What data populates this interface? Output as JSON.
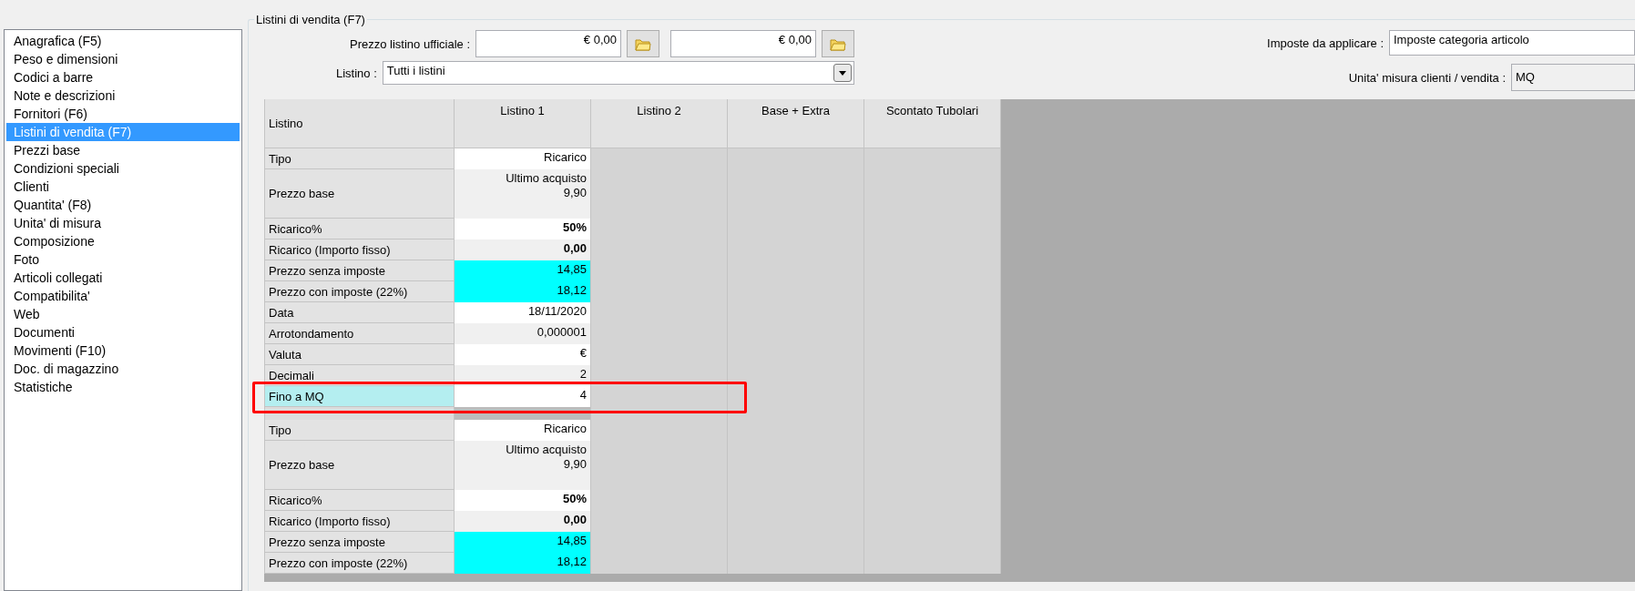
{
  "sidebar": {
    "items": [
      {
        "label": "Anagrafica (F5)",
        "selected": false
      },
      {
        "label": "Peso e dimensioni",
        "selected": false
      },
      {
        "label": "Codici a barre",
        "selected": false
      },
      {
        "label": "Note e descrizioni",
        "selected": false
      },
      {
        "label": "Fornitori (F6)",
        "selected": false
      },
      {
        "label": "Listini di vendita (F7)",
        "selected": true
      },
      {
        "label": "Prezzi base",
        "selected": false
      },
      {
        "label": "Condizioni speciali",
        "selected": false
      },
      {
        "label": "Clienti",
        "selected": false
      },
      {
        "label": "Quantita' (F8)",
        "selected": false
      },
      {
        "label": "Unita' di misura",
        "selected": false
      },
      {
        "label": "Composizione",
        "selected": false
      },
      {
        "label": "Foto",
        "selected": false
      },
      {
        "label": "Articoli collegati",
        "selected": false
      },
      {
        "label": "Compatibilita'",
        "selected": false
      },
      {
        "label": "Web",
        "selected": false
      },
      {
        "label": "Documenti",
        "selected": false
      },
      {
        "label": "Movimenti (F10)",
        "selected": false
      },
      {
        "label": "Doc. di magazzino",
        "selected": false
      },
      {
        "label": "Statistiche",
        "selected": false
      }
    ]
  },
  "panel": {
    "title": "Listini di vendita (F7)",
    "official_price": {
      "label": "Prezzo listino ufficiale :",
      "values": [
        "€ 0,00",
        "€ 0,00"
      ]
    },
    "price_list": {
      "label": "Listino :",
      "value": "Tutti i listini"
    },
    "taxes": {
      "label": "Imposte da applicare :",
      "value": "Imposte categoria articolo"
    },
    "unit": {
      "label": "Unita' misura clienti / vendita :",
      "value": "MQ"
    }
  },
  "grid": {
    "columns": [
      "Listino",
      "Listino 1",
      "Listino 2",
      "Base + Extra",
      "Scontato Tubolari"
    ],
    "blocks": [
      {
        "rows": [
          {
            "label": "Tipo",
            "value": "Ricarico",
            "kind": "single",
            "color": "#ffffff",
            "bold": false,
            "selected": false,
            "highlighted": false
          },
          {
            "label": "Prezzo base",
            "value": "Ultimo acquisto\n9,90",
            "kind": "double",
            "color": "#f0f0f0",
            "bold": false,
            "selected": false,
            "highlighted": false
          },
          {
            "label": "Ricarico%",
            "value": "50%",
            "kind": "single",
            "color": "#ffffff",
            "bold": true,
            "selected": false,
            "highlighted": false
          },
          {
            "label": "Ricarico (Importo fisso)",
            "value": "0,00",
            "kind": "single",
            "color": "#f0f0f0",
            "bold": true,
            "selected": false,
            "highlighted": false
          },
          {
            "label": "Prezzo senza imposte",
            "value": "14,85",
            "kind": "single",
            "color": "#00ffff",
            "bold": false,
            "selected": false,
            "highlighted": false
          },
          {
            "label": "Prezzo con imposte (22%)",
            "value": "18,12",
            "kind": "single",
            "color": "#00ffff",
            "bold": false,
            "selected": false,
            "highlighted": false
          },
          {
            "label": "Data",
            "value": "18/11/2020",
            "kind": "single",
            "color": "#ffffff",
            "bold": false,
            "selected": false,
            "highlighted": false
          },
          {
            "label": "Arrotondamento",
            "value": "0,000001",
            "kind": "single",
            "color": "#f0f0f0",
            "bold": false,
            "selected": false,
            "highlighted": false
          },
          {
            "label": "Valuta",
            "value": "€",
            "kind": "single",
            "color": "#ffffff",
            "bold": false,
            "selected": false,
            "highlighted": false
          },
          {
            "label": "Decimali",
            "value": "2",
            "kind": "single",
            "color": "#f0f0f0",
            "bold": false,
            "selected": false,
            "highlighted": false
          },
          {
            "label": "Fino a MQ",
            "value": "4",
            "kind": "single",
            "color": "#ffffff",
            "bold": false,
            "selected": true,
            "highlighted": true
          }
        ]
      },
      {
        "rows": [
          {
            "label": "Tipo",
            "value": "Ricarico",
            "kind": "single",
            "color": "#ffffff",
            "bold": false,
            "selected": false,
            "highlighted": false
          },
          {
            "label": "Prezzo base",
            "value": "Ultimo acquisto\n9,90",
            "kind": "double",
            "color": "#f0f0f0",
            "bold": false,
            "selected": false,
            "highlighted": false
          },
          {
            "label": "Ricarico%",
            "value": "50%",
            "kind": "single",
            "color": "#ffffff",
            "bold": true,
            "selected": false,
            "highlighted": false
          },
          {
            "label": "Ricarico (Importo fisso)",
            "value": "0,00",
            "kind": "single",
            "color": "#f0f0f0",
            "bold": true,
            "selected": false,
            "highlighted": false
          },
          {
            "label": "Prezzo senza imposte",
            "value": "14,85",
            "kind": "single",
            "color": "#00ffff",
            "bold": false,
            "selected": false,
            "highlighted": false
          },
          {
            "label": "Prezzo con imposte (22%)",
            "value": "18,12",
            "kind": "single",
            "color": "#00ffff",
            "bold": false,
            "selected": false,
            "highlighted": false
          }
        ]
      }
    ]
  }
}
